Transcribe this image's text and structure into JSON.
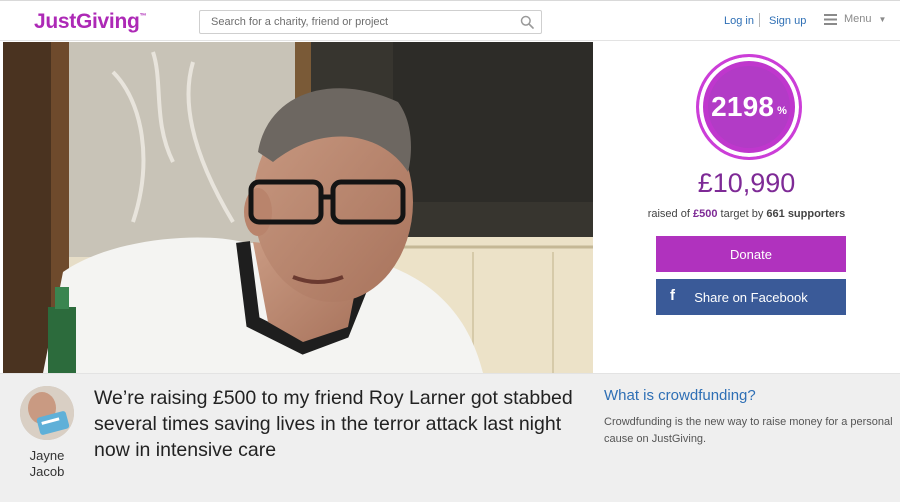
{
  "header": {
    "logo": "JustGiving",
    "logo_tm": "™",
    "search_placeholder": "Search for a charity, friend or project",
    "login": "Log in",
    "signup": "Sign up",
    "menu": "Menu"
  },
  "fundraiser": {
    "percent": "2198",
    "percent_sign": "%",
    "amount": "£10,990",
    "raised_of": "raised of",
    "target_amount": "£500",
    "target_word": "target by",
    "supporters_count": "661",
    "supporters_word": "supporters",
    "donate_label": "Donate",
    "facebook_label": "Share on Facebook"
  },
  "story": {
    "title": "We’re raising £500 to my friend Roy Larner got stabbed several times saving lives in the terror attack last night now in intensive care",
    "owner_first": "Jayne",
    "owner_last": "Jacob"
  },
  "crowdfunding": {
    "title": "What is crowdfunding?",
    "text": "Crowdfunding is the new way to raise money for a personal cause on JustGiving."
  },
  "colors": {
    "brand_purple": "#ad29b6",
    "facebook_blue": "#3a5a98",
    "link_blue": "#2e6fb5"
  }
}
